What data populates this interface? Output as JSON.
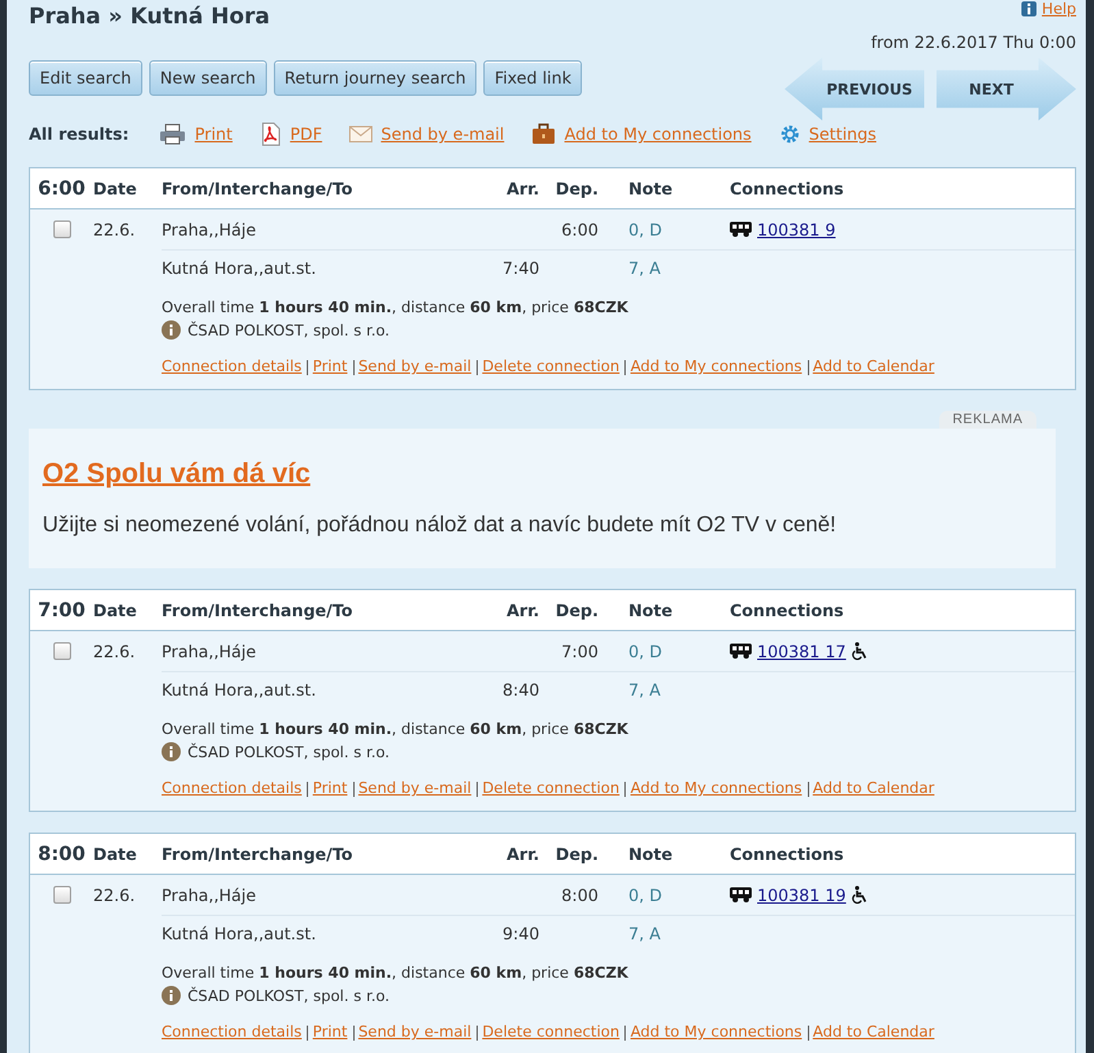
{
  "header": {
    "title": "Praha » Kutná Hora",
    "help": "Help",
    "date_range": "from 22.6.2017 Thu 0:00"
  },
  "buttons": [
    "Edit search",
    "New search",
    "Return journey search",
    "Fixed link"
  ],
  "nav": {
    "previous": "PREVIOUS",
    "next": "NEXT"
  },
  "all_results": {
    "label": "All results:",
    "actions": [
      {
        "kind": "print",
        "label": "Print"
      },
      {
        "kind": "pdf",
        "label": "PDF"
      },
      {
        "kind": "email",
        "label": "Send by e-mail"
      },
      {
        "kind": "briefcase",
        "label": "Add to My connections"
      },
      {
        "kind": "settings",
        "label": "Settings"
      }
    ]
  },
  "results": [
    {
      "kind": "connection",
      "time": "6:00",
      "columns": [
        "Date",
        "From/Interchange/To",
        "Arr.",
        "Dep.",
        "Note",
        "Connections"
      ],
      "selected": false,
      "date": "22.6.",
      "stops": [
        {
          "station": "Praha,,Háje",
          "dep": "6:00",
          "note": "0, D"
        },
        {
          "station": "Kutná Hora,,aut.st.",
          "arr": "7:40",
          "note": "7, A"
        }
      ],
      "line": {
        "number": "100381 9",
        "wheelchair": false
      },
      "summary": "Overall time **1 hours 40 min.**, distance **60 km**, price **68CZK**",
      "operator": "ČSAD POLKOST, spol. s r.o.",
      "actions": [
        "Connection details",
        "Print",
        "Send by e-mail",
        "Delete connection",
        "Add to My connections",
        "Add to Calendar"
      ]
    },
    {
      "kind": "ad",
      "badge": "REKLAMA",
      "title": "O2 Spolu vám dá víc",
      "text": "Užijte si neomezené volání, pořádnou nálož dat a navíc budete mít O2 TV v ceně!"
    },
    {
      "kind": "connection",
      "time": "7:00",
      "columns": [
        "Date",
        "From/Interchange/To",
        "Arr.",
        "Dep.",
        "Note",
        "Connections"
      ],
      "selected": false,
      "date": "22.6.",
      "stops": [
        {
          "station": "Praha,,Háje",
          "dep": "7:00",
          "note": "0, D"
        },
        {
          "station": "Kutná Hora,,aut.st.",
          "arr": "8:40",
          "note": "7, A"
        }
      ],
      "line": {
        "number": "100381 17",
        "wheelchair": true
      },
      "summary": "Overall time **1 hours 40 min.**, distance **60 km**, price **68CZK**",
      "operator": "ČSAD POLKOST, spol. s r.o.",
      "actions": [
        "Connection details",
        "Print",
        "Send by e-mail",
        "Delete connection",
        "Add to My connections",
        "Add to Calendar"
      ]
    },
    {
      "kind": "connection",
      "time": "8:00",
      "columns": [
        "Date",
        "From/Interchange/To",
        "Arr.",
        "Dep.",
        "Note",
        "Connections"
      ],
      "selected": false,
      "date": "22.6.",
      "stops": [
        {
          "station": "Praha,,Háje",
          "dep": "8:00",
          "note": "0, D"
        },
        {
          "station": "Kutná Hora,,aut.st.",
          "arr": "9:40",
          "note": "7, A"
        }
      ],
      "line": {
        "number": "100381 19",
        "wheelchair": true
      },
      "summary": "Overall time **1 hours 40 min.**, distance **60 km**, price **68CZK**",
      "operator": "ČSAD POLKOST, spol. s r.o.",
      "actions": [
        "Connection details",
        "Print",
        "Send by e-mail",
        "Delete connection",
        "Add to My connections",
        "Add to Calendar"
      ]
    }
  ]
}
